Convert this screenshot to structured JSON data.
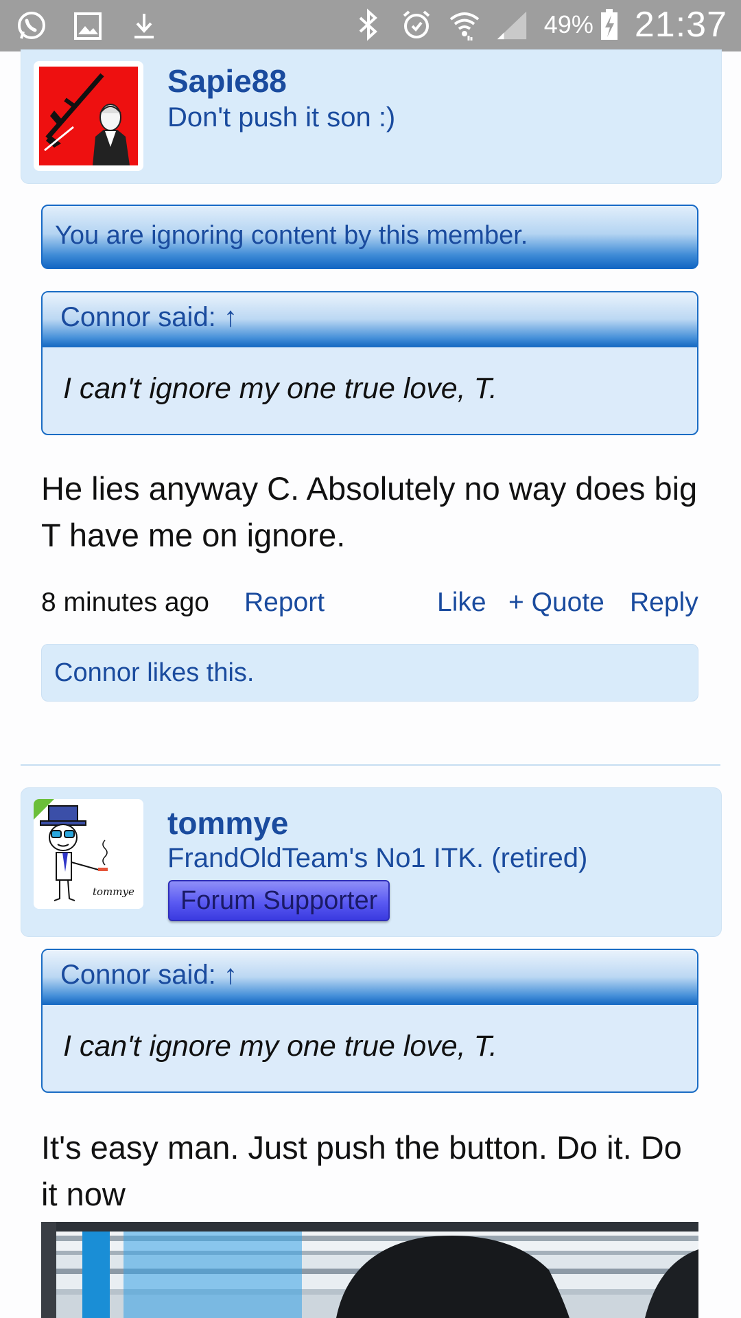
{
  "status_bar": {
    "battery": "49%",
    "time": "21:37",
    "icons": [
      "whatsapp-icon",
      "gallery-icon",
      "download-icon",
      "bluetooth-icon",
      "alarm-icon",
      "wifi-icon",
      "signal-icon",
      "battery-charging-icon"
    ]
  },
  "post1": {
    "username": "Sapie88",
    "user_title": "Don't push it son :)",
    "ignored_notice": "You are ignoring content by this member.",
    "quote": {
      "header": "Connor said: ↑",
      "text": "I can't ignore my one true love, T."
    },
    "message": "He lies anyway C. Absolutely no way does big T have me on ignore.",
    "time_ago": "8 minutes ago",
    "report": "Report",
    "like": "Like",
    "quote_action": "+ Quote",
    "reply": "Reply",
    "likes_summary": "Connor likes this."
  },
  "post2": {
    "username": "tommye",
    "user_title": "FrandOldTeam's No1 ITK. (retired)",
    "badge": "Forum Supporter",
    "avatar_signature": "tommye",
    "quote": {
      "header": "Connor said: ↑",
      "text": "I can't ignore my one true love, T."
    },
    "message": "It's easy man. Just push the button. Do it. Do it now"
  },
  "colors": {
    "link": "#1a4b9e",
    "card_bg": "#d9ebfa",
    "status_bar": "#9e9e9e",
    "quote_border": "#1a6cc4"
  }
}
